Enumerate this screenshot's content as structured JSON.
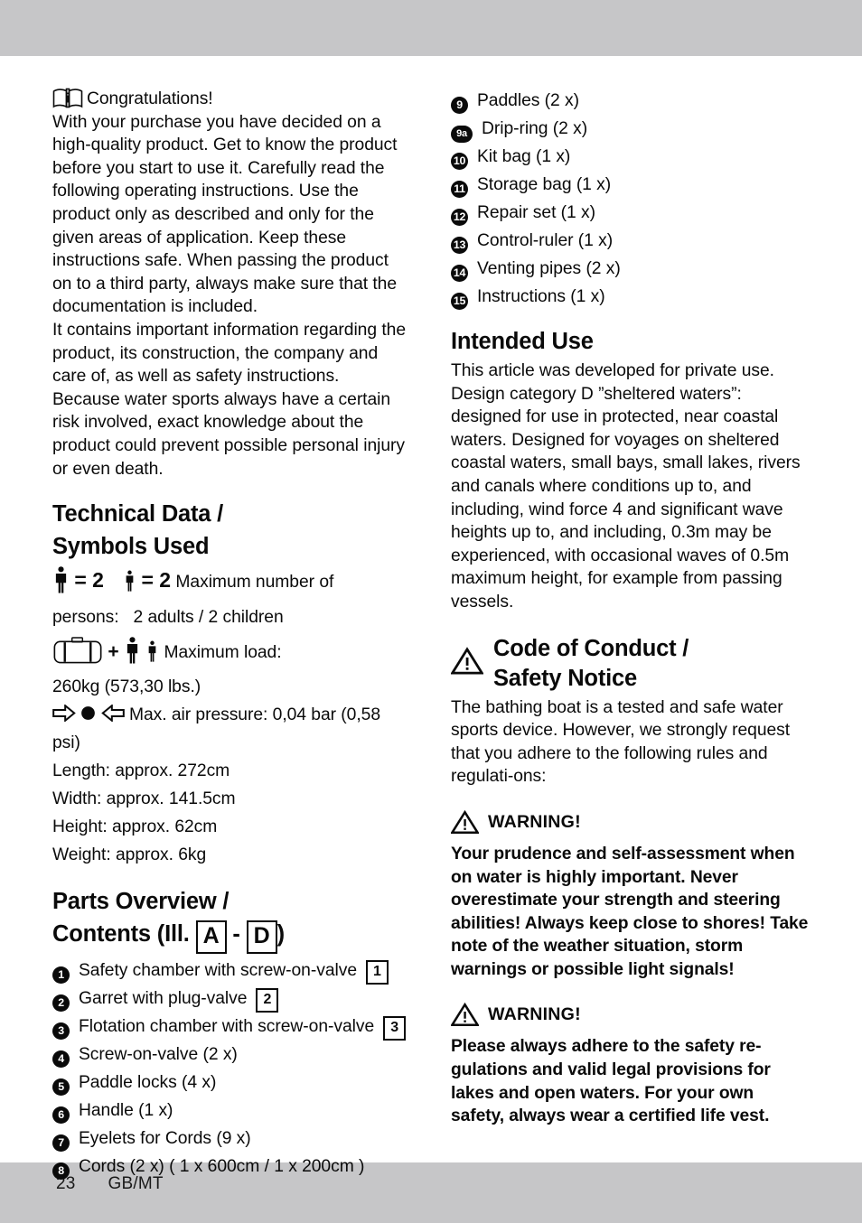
{
  "page": {
    "number": "23",
    "locale": "GB/MT"
  },
  "icons": {
    "book": "book-info-icon",
    "adult": "adult-person-icon",
    "child": "child-person-icon",
    "suitcase": "suitcase-icon",
    "arrow_right": "arrow-right-icon",
    "arrow_left": "arrow-left-icon",
    "dot": "filled-circle-icon",
    "warning": "warning-triangle-icon"
  },
  "colors": {
    "band_grey": "#c6c6c8",
    "text": "#0a0a0a"
  },
  "left": {
    "congrats_title": "Congratulations!",
    "intro_paragraph": "With your purchase you have decided on a high-quality product. Get to know the product before you start to use it. Carefully read the following operating instructions. Use the product only as described and only for the given areas of application. Keep these instructions safe. When passing the product on to a third party, always make sure that the documentation is included.",
    "intro_paragraph_2": "It contains important information regarding the product, its construction, the company and care of, as well as safety instructions. Because water sports always have a certain risk involved, exact knowledge about the product could prevent possible personal injury or even death.",
    "technical_heading_line1": "Technical Data /",
    "technical_heading_line2": "Symbols Used",
    "persons_equals_adult": "= 2",
    "persons_equals_child": "= 2",
    "persons_label": "Maximum number of",
    "persons_value": "persons:   2 adults / 2 children",
    "load_plus": "+",
    "load_label": "Maximum load:",
    "load_value": "260kg (573,30 lbs.)",
    "pressure_text": "Max. air pressure: 0,04 bar (0,58 psi)",
    "length": "Length: approx. 272cm",
    "width": "Width: approx. 141.5cm",
    "height": "Height: approx. 62cm",
    "weight": "Weight: approx. 6kg",
    "parts_heading_line1": "Parts Overview /",
    "parts_heading_line2_pre": "Contents (Ill.",
    "parts_heading_letter_a": "A",
    "parts_heading_dash": "-",
    "parts_heading_letter_d": "D",
    "parts_heading_line2_post": ")",
    "parts": [
      {
        "num": "1",
        "text": "Safety chamber with screw-on-valve",
        "badge": "1"
      },
      {
        "num": "2",
        "text": "Garret with plug-valve",
        "badge": "2"
      },
      {
        "num": "3",
        "text": "Flotation chamber with screw-on-valve",
        "badge": "3"
      },
      {
        "num": "4",
        "text": "Screw-on-valve (2 x)",
        "badge": ""
      },
      {
        "num": "5",
        "text": "Paddle locks (4 x)",
        "badge": ""
      },
      {
        "num": "6",
        "text": "Handle (1 x)",
        "badge": ""
      },
      {
        "num": "7",
        "text": "Eyelets for Cords (9 x)",
        "badge": ""
      },
      {
        "num": "8",
        "text": "Cords (2 x) ( 1 x 600cm / 1 x 200cm )",
        "badge": ""
      }
    ]
  },
  "right": {
    "parts": [
      {
        "num": "9",
        "text": "Paddles (2 x)",
        "wide": false
      },
      {
        "num": "9a",
        "text": "Drip-ring (2 x)",
        "wide": true
      },
      {
        "num": "10",
        "text": "Kit bag (1 x)",
        "wide": false
      },
      {
        "num": "11",
        "text": "Storage bag (1 x)",
        "wide": false
      },
      {
        "num": "12",
        "text": "Repair set (1 x)",
        "wide": false
      },
      {
        "num": "13",
        "text": "Control-ruler (1 x)",
        "wide": false
      },
      {
        "num": "14",
        "text": "Venting pipes (2 x)",
        "wide": false
      },
      {
        "num": "15",
        "text": "Instructions (1 x)",
        "wide": false
      }
    ],
    "intended_use_heading": "Intended Use",
    "intended_use_body": "This article was developed for private use. Design category D ”sheltered waters”: designed for use in protected, near coastal waters. Designed for voyages on sheltered coastal waters, small bays, small lakes, rivers and canals where conditions up to, and including, wind force 4 and significant wave heights up to, and including, 0.3m may be experienced, with occasional waves of 0.5m maximum height, for example from passing vessels.",
    "code_heading_line1": "Code of Conduct /",
    "code_heading_line2": "Safety Notice",
    "code_body": "The bathing boat is a tested and safe water sports device. However, we strongly request that you adhere to the following rules and regulati-ons:",
    "warning_label_1": "WARNING!",
    "warning_body_1": "Your prudence and self-assessment when on water is highly important. Never overestimate your strength and steering abilities! Always keep close to shores! Take note of the weather situation, storm warnings or possible light signals!",
    "warning_label_2": "WARNING!",
    "warning_body_2": "Please always adhere to the safety re-gulations and valid legal provisions for lakes and open waters. For your own safety, always wear a certified life vest."
  }
}
